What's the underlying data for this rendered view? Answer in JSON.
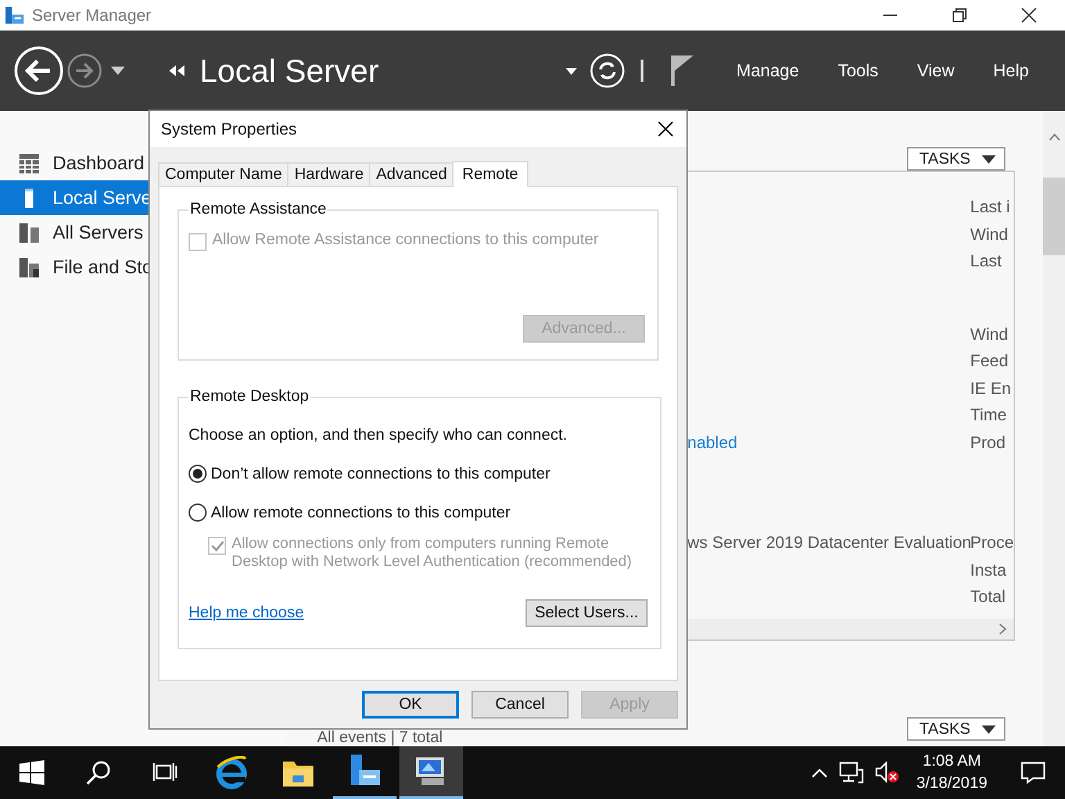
{
  "window": {
    "title": "Server Manager"
  },
  "header": {
    "title": "Local Server",
    "menu": [
      "Manage",
      "Tools",
      "View",
      "Help"
    ]
  },
  "sidebar": {
    "items": [
      {
        "label": "Dashboard",
        "kind": "dashboard",
        "selected": false
      },
      {
        "label": "Local Serve",
        "kind": "server",
        "selected": true
      },
      {
        "label": "All Servers",
        "kind": "servers",
        "selected": false
      },
      {
        "label": "File and Sto",
        "kind": "files",
        "selected": false
      }
    ]
  },
  "properties": {
    "tasks": "TASKS",
    "groups": [
      [
        {
          "label": "Last i"
        },
        {
          "label": "Wind"
        },
        {
          "label": "Last"
        }
      ],
      [
        {
          "label": "Wind"
        },
        {
          "label": "Feed"
        },
        {
          "label": "IE En"
        },
        {
          "label": "Time"
        },
        {
          "label": "Prod",
          "value": "nabled",
          "link": true
        }
      ],
      [
        {
          "label": "Proce",
          "value": "ws Server 2019 Datacenter Evaluation",
          "link": false
        },
        {
          "label": "Insta"
        },
        {
          "label": "Total"
        }
      ]
    ]
  },
  "events": {
    "summary": "All events | 7 total",
    "tasks": "TASKS"
  },
  "dialog": {
    "title": "System Properties",
    "tabs": [
      {
        "label": "Computer Name",
        "selected": false
      },
      {
        "label": "Hardware",
        "selected": false
      },
      {
        "label": "Advanced",
        "selected": false
      },
      {
        "label": "Remote",
        "selected": true
      }
    ],
    "remote_assistance": {
      "title": "Remote Assistance",
      "allow": {
        "label": "Allow Remote Assistance connections to this computer",
        "checked": false,
        "disabled": true
      },
      "advanced_button": {
        "label": "Advanced...",
        "disabled": true
      }
    },
    "remote_desktop": {
      "title": "Remote Desktop",
      "instruction": "Choose an option, and then specify who can connect.",
      "options": [
        {
          "label": "Don’t allow remote connections to this computer",
          "selected": true
        },
        {
          "label": "Allow remote connections to this computer",
          "selected": false
        }
      ],
      "nla": {
        "label": "Allow connections only from computers running Remote Desktop with Network Level Authentication (recommended)",
        "checked": true,
        "disabled": true
      },
      "help_link": "Help me choose",
      "select_users": "Select Users..."
    },
    "buttons": [
      {
        "label": "OK",
        "kind": "default"
      },
      {
        "label": "Cancel",
        "kind": "normal"
      },
      {
        "label": "Apply",
        "kind": "disabled"
      }
    ]
  },
  "taskbar": {
    "apps": [
      {
        "kind": "browser",
        "running": false,
        "selected": false
      },
      {
        "kind": "folder",
        "running": false,
        "selected": false
      },
      {
        "kind": "server-manager",
        "running": true,
        "selected": false
      },
      {
        "kind": "system-properties",
        "running": true,
        "selected": true
      }
    ],
    "time": "1:08 AM",
    "date": "3/18/2019"
  }
}
